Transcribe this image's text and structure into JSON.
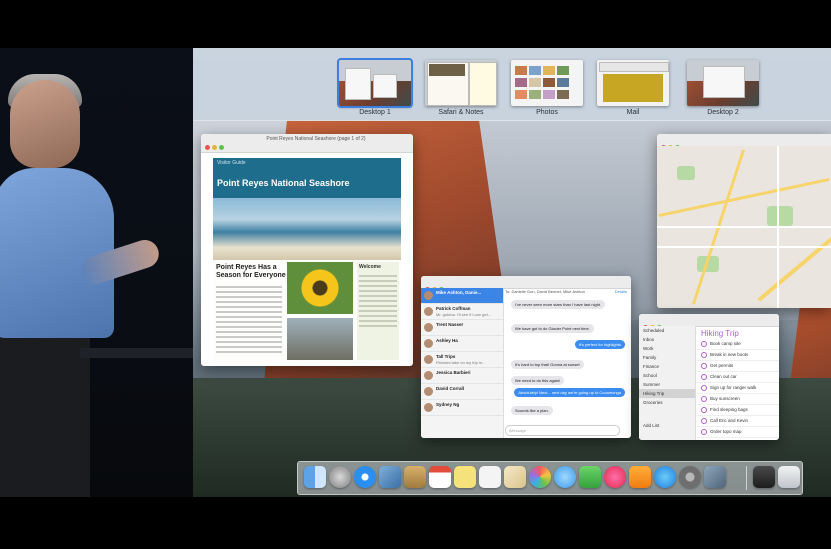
{
  "mission_control": {
    "spaces": [
      {
        "label": "Desktop 1",
        "active": true
      },
      {
        "label": "Safari & Notes",
        "active": false
      },
      {
        "label": "Photos",
        "active": false
      },
      {
        "label": "Mail",
        "active": false
      },
      {
        "label": "Desktop 2",
        "active": false
      }
    ]
  },
  "safari": {
    "tab_title": "Point Reyes National Seashore (page 1 of 2)",
    "page_small_header": "Visitor Guide",
    "page_title": "Point Reyes National Seashore",
    "article_title": "Point Reyes Has a Season for Everyone",
    "sidebar_heading": "Welcome"
  },
  "messages": {
    "to_line": "To: Danielle Gun, David Bennet, Mike Ashton",
    "details_label": "Details",
    "search_placeholder": "Search",
    "conversations": [
      {
        "name": "Mike Ashton, Danie...",
        "preview": "",
        "selected": true
      },
      {
        "name": "Patrick Coffman",
        "preview": "Mr. gotcha. I'll see if I can get...",
        "selected": false
      },
      {
        "name": "Trent Nasser",
        "preview": "",
        "selected": false
      },
      {
        "name": "Ashley Ha",
        "preview": "",
        "selected": false
      },
      {
        "name": "Tall Trips",
        "preview": "Pictures take on my trip in...",
        "selected": false
      },
      {
        "name": "Jessica Barbieri",
        "preview": "",
        "selected": false
      },
      {
        "name": "David Corrall",
        "preview": "",
        "selected": false
      },
      {
        "name": "Sydney Ng",
        "preview": "",
        "selected": false
      }
    ],
    "bubbles": [
      {
        "text": "I've never seen more stars than I have last night.",
        "dir": "in"
      },
      {
        "text": "We have got to do Glacier Point next time.",
        "dir": "in"
      },
      {
        "text": "It's perfect for highlights",
        "dir": "out"
      },
      {
        "text": "It's hard to top that! Gonna at sunset",
        "dir": "in"
      },
      {
        "text": "We need to do this again!",
        "dir": "in"
      },
      {
        "text": "Absolutely! Next... next day we're going up to Cucamonga",
        "dir": "out"
      },
      {
        "text": "Sounds like a plan.",
        "dir": "in"
      }
    ],
    "compose_placeholder": "iMessage"
  },
  "reminders": {
    "lists": [
      "Scheduled",
      "Inbox",
      "Work",
      "Family",
      "Finance",
      "School",
      "Summer",
      "Hiking Trip",
      "Groceries"
    ],
    "selected_list": "Hiking Trip",
    "add_list_label": "Add List",
    "title": "Hiking Trip",
    "items": [
      "Book camp site",
      "Break in new boots",
      "Get permits",
      "Clean out car",
      "Sign up for ranger walk",
      "Buy sunscreen",
      "Find sleeping bags",
      "Call Eric and Kevin",
      "Order topo map"
    ]
  },
  "dock": {
    "apps": [
      "Finder",
      "Launchpad",
      "Safari",
      "Preview",
      "Notes",
      "Calendar",
      "Stickies",
      "Reminders",
      "Pages",
      "Photos",
      "Messages",
      "FaceTime",
      "iTunes",
      "iBooks",
      "App Store",
      "System Preferences",
      "Image Capture",
      "Downloads",
      "Trash"
    ]
  },
  "colors": {
    "accent": "#3b85e6",
    "reminder_accent": "#b35bd0"
  }
}
